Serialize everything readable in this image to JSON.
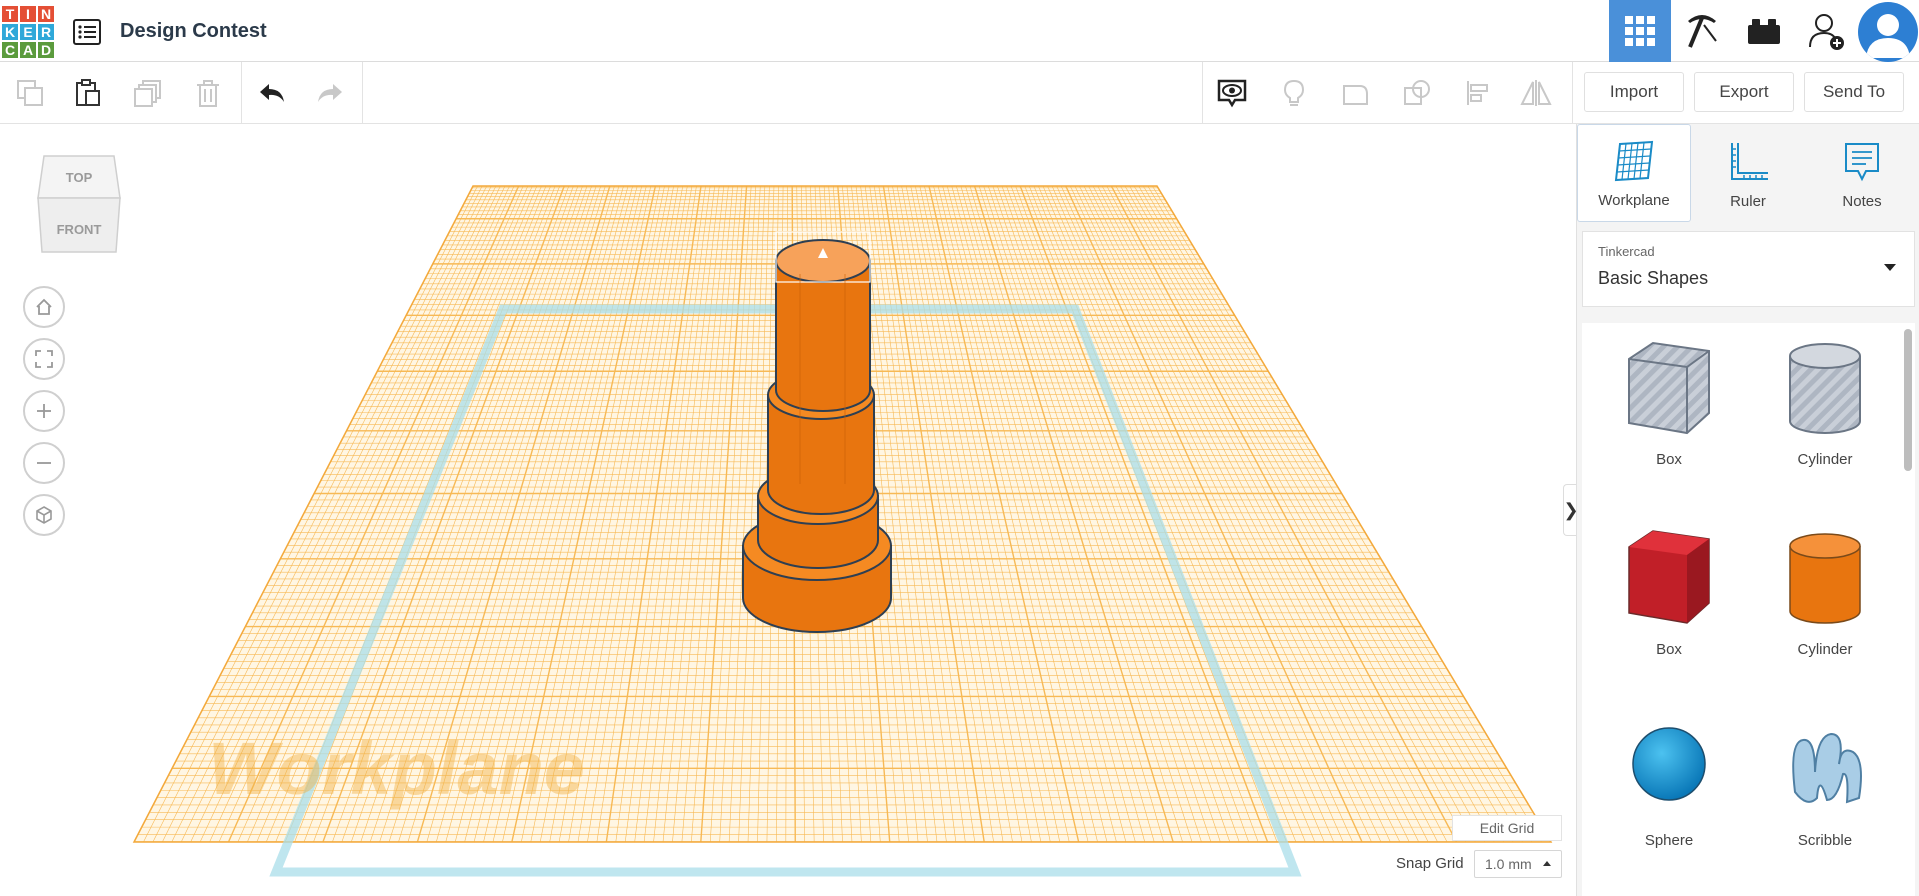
{
  "header": {
    "logo_letters": [
      "T",
      "I",
      "N",
      "K",
      "E",
      "R",
      "C",
      "A",
      "D"
    ],
    "logo_colors": [
      "#e44f35",
      "#e44f35",
      "#e44f35",
      "#2fa8d9",
      "#2fa8d9",
      "#2fa8d9",
      "#5b9b3d",
      "#5b9b3d",
      "#5b9b3d"
    ],
    "design_title": "Design Contest",
    "icons": [
      "grid-view-icon",
      "pickaxe-icon",
      "bricks-icon",
      "add-user-icon",
      "user-avatar"
    ]
  },
  "toolbar": {
    "import_label": "Import",
    "export_label": "Export",
    "send_to_label": "Send To"
  },
  "canvas": {
    "viewcube_top": "TOP",
    "viewcube_front": "FRONT",
    "workplane_watermark": "Workplane",
    "edit_grid_label": "Edit Grid",
    "snap_grid_label": "Snap Grid",
    "snap_grid_value": "1.0 mm"
  },
  "panel": {
    "tabs": [
      {
        "label": "Workplane"
      },
      {
        "label": "Ruler"
      },
      {
        "label": "Notes"
      }
    ],
    "library_source": "Tinkercad",
    "library_name": "Basic Shapes",
    "shapes": [
      {
        "label": "Box"
      },
      {
        "label": "Cylinder"
      },
      {
        "label": "Box"
      },
      {
        "label": "Cylinder"
      },
      {
        "label": "Sphere"
      },
      {
        "label": "Scribble"
      }
    ]
  },
  "colors": {
    "accent": "#4a90d9",
    "workplane_grid": "#f7b955",
    "shape_orange": "#e8750f",
    "shape_red": "#d4212c",
    "shape_blue": "#1a9ad7"
  }
}
